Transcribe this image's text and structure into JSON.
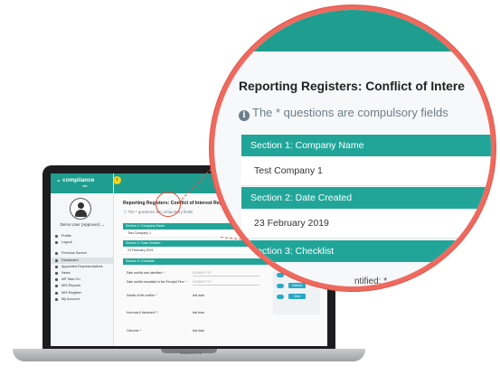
{
  "sidebar": {
    "logo": "compliance",
    "logo_sub": "star",
    "collapse_icon": "‹",
    "user": "Demo User (Approver) ⌄",
    "items": [
      {
        "label": "Profile",
        "icon": "user-icon"
      },
      {
        "label": "Logout",
        "icon": "logout-icon"
      },
      {
        "label": "Previous Screen",
        "icon": "back-icon"
      },
      {
        "label": "Dashboard",
        "icon": "dashboard-icon",
        "active": true
      },
      {
        "label": "Appointed Representatives",
        "icon": "people-icon"
      },
      {
        "label": "News",
        "icon": "news-icon"
      },
      {
        "label": "AR Take-On",
        "icon": "takeon-icon"
      },
      {
        "label": "MIS Reports",
        "icon": "reports-icon"
      },
      {
        "label": "MIS Register",
        "icon": "register-icon"
      },
      {
        "label": "My Account",
        "icon": "account-icon"
      }
    ]
  },
  "main": {
    "title": "Reporting Registers: Conflict of Interest Regis",
    "note": "The * questions are compulsory fields",
    "sections": [
      {
        "header": "Section 1: Company Name",
        "value": "Test Company 1"
      },
      {
        "header": "Section 2: Date Created",
        "value": "23 February 2019"
      },
      {
        "header": "Section 3: Checklist",
        "value": ""
      }
    ],
    "checklist": [
      {
        "q": "Date conflict was identified: *",
        "a": "",
        "placeholder": "DD/MM/YYYY"
      },
      {
        "q": "Date conflict escalated to the Principal Firm: *",
        "a": "",
        "placeholder": "DD/MM/YYYY"
      },
      {
        "q": "Details of the conflict: *",
        "a": "test data",
        "placeholder": ""
      },
      {
        "q": "How was it disclosed? *",
        "a": "test data",
        "placeholder": ""
      },
      {
        "q": "Outcome: *",
        "a": "test data",
        "placeholder": ""
      }
    ],
    "attachments": [
      {
        "button": "View"
      },
      {
        "button": "Internal"
      },
      {
        "button": "View"
      }
    ]
  },
  "laptop": {
    "label": "MacBook Pro"
  },
  "zoom": {
    "title": "Reporting Registers: Conflict of Intere",
    "note": "The * questions are compulsory fields",
    "info_icon": "i",
    "sections": [
      {
        "header": "Section 1: Company Name",
        "value": "Test Company 1"
      },
      {
        "header": "Section 2: Date Created",
        "value": "23 February 2019"
      },
      {
        "header": "Section 3: Checklist",
        "value": ""
      }
    ],
    "peek_left": "",
    "peek_right": "ntified: *"
  },
  "colors": {
    "teal": "#1f9d8f",
    "section": "#22a599",
    "accent_ring": "#ef6a5e",
    "button": "#2aa8c4",
    "collapse": "#f2d21b"
  }
}
